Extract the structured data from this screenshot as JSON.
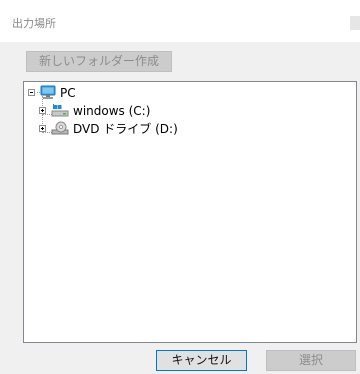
{
  "dialog": {
    "title": "出力場所",
    "new_folder_label": "新しいフォルダー作成",
    "cancel_label": "キャンセル",
    "select_label": "選択"
  },
  "tree": {
    "root": {
      "label": "PC",
      "icon": "computer-icon",
      "expanded": true
    },
    "children": [
      {
        "label": "windows (C:)",
        "icon": "windows-drive-icon",
        "expanded": false
      },
      {
        "label": "DVD ドライブ (D:)",
        "icon": "dvd-drive-icon",
        "expanded": false
      }
    ]
  },
  "colors": {
    "accent_border": "#0078d7",
    "disabled_button": "#cccccc",
    "dialog_background": "#f0f0f0"
  }
}
